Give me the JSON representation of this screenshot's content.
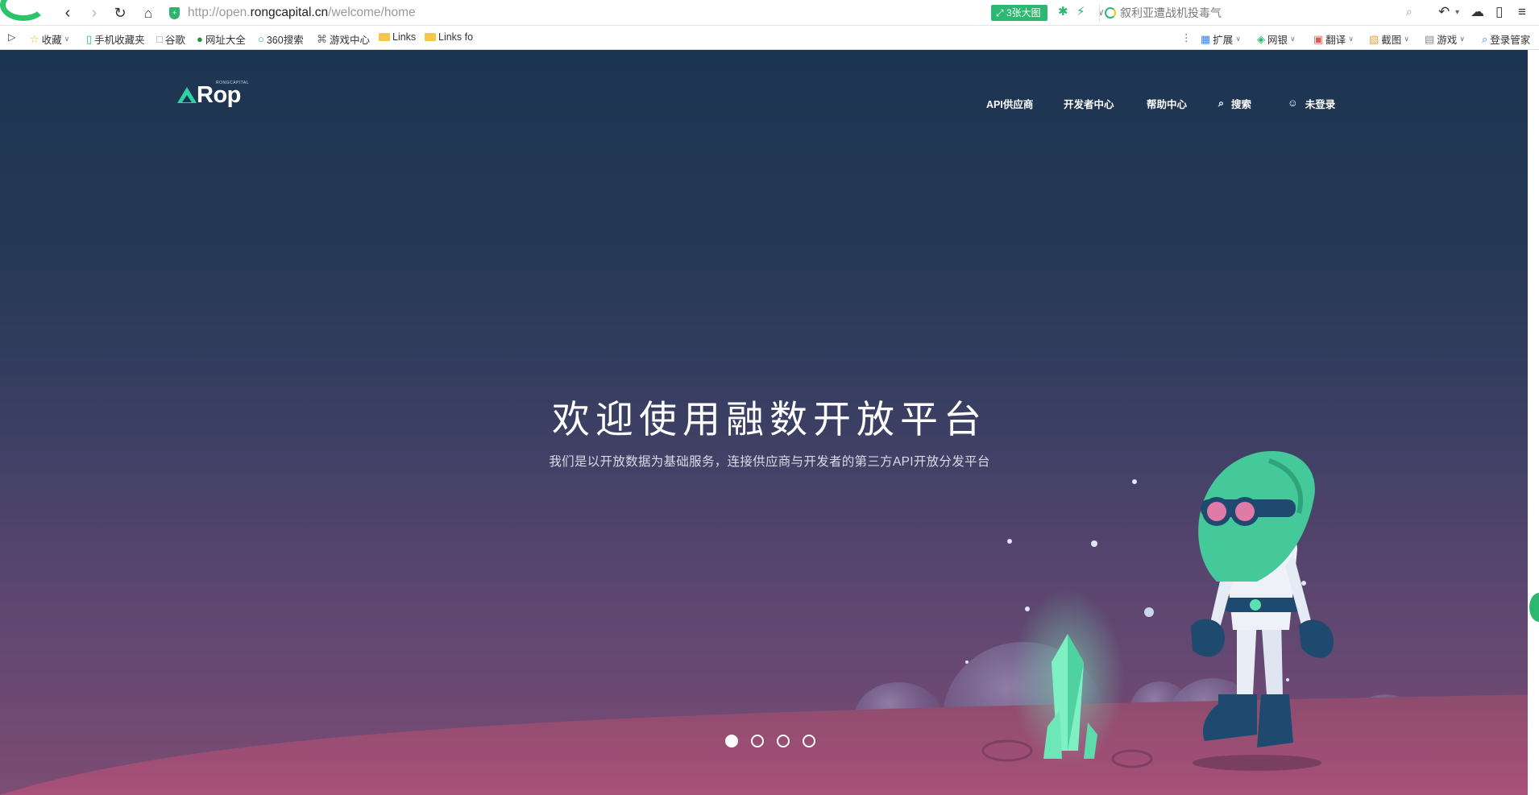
{
  "browser": {
    "url_prefix": "http://open.",
    "url_host": "rongcapital.cn",
    "url_path": "/welcome/home",
    "bigpic_label": "3张大图",
    "search_placeholder": "叙利亚遭战机投毒气",
    "bookmarks": [
      {
        "label": "收藏",
        "icon": "star-icon"
      },
      {
        "label": "手机收藏夹",
        "icon": "phone-icon"
      },
      {
        "label": "谷歌",
        "icon": "page-icon"
      },
      {
        "label": "网址大全",
        "icon": "globe-icon"
      },
      {
        "label": "360搜索",
        "icon": "search-360-icon"
      },
      {
        "label": "游戏中心",
        "icon": "gamepad-icon"
      },
      {
        "label": "Links",
        "icon": "folder-icon"
      },
      {
        "label": "Links fo",
        "icon": "folder-icon"
      }
    ],
    "right_tools": [
      {
        "label": "扩展",
        "icon": "extension-icon"
      },
      {
        "label": "网银",
        "icon": "bank-icon"
      },
      {
        "label": "翻译",
        "icon": "translate-icon"
      },
      {
        "label": "截图",
        "icon": "screenshot-icon"
      },
      {
        "label": "游戏",
        "icon": "game-icon"
      },
      {
        "label": "登录管家",
        "icon": "login-manager-icon"
      }
    ]
  },
  "site": {
    "logo_text": "Rop",
    "logo_small": "RONGCAPITAL",
    "nav": {
      "api": "API供应商",
      "dev": "开发者中心",
      "help": "帮助中心",
      "search": "搜索",
      "login": "未登录"
    }
  },
  "hero": {
    "title": "欢迎使用融数开放平台",
    "subtitle": "我们是以开放数据为基础服务，连接供应商与开发者的第三方API开放分发平台",
    "slides": 4,
    "active_slide": 1
  }
}
